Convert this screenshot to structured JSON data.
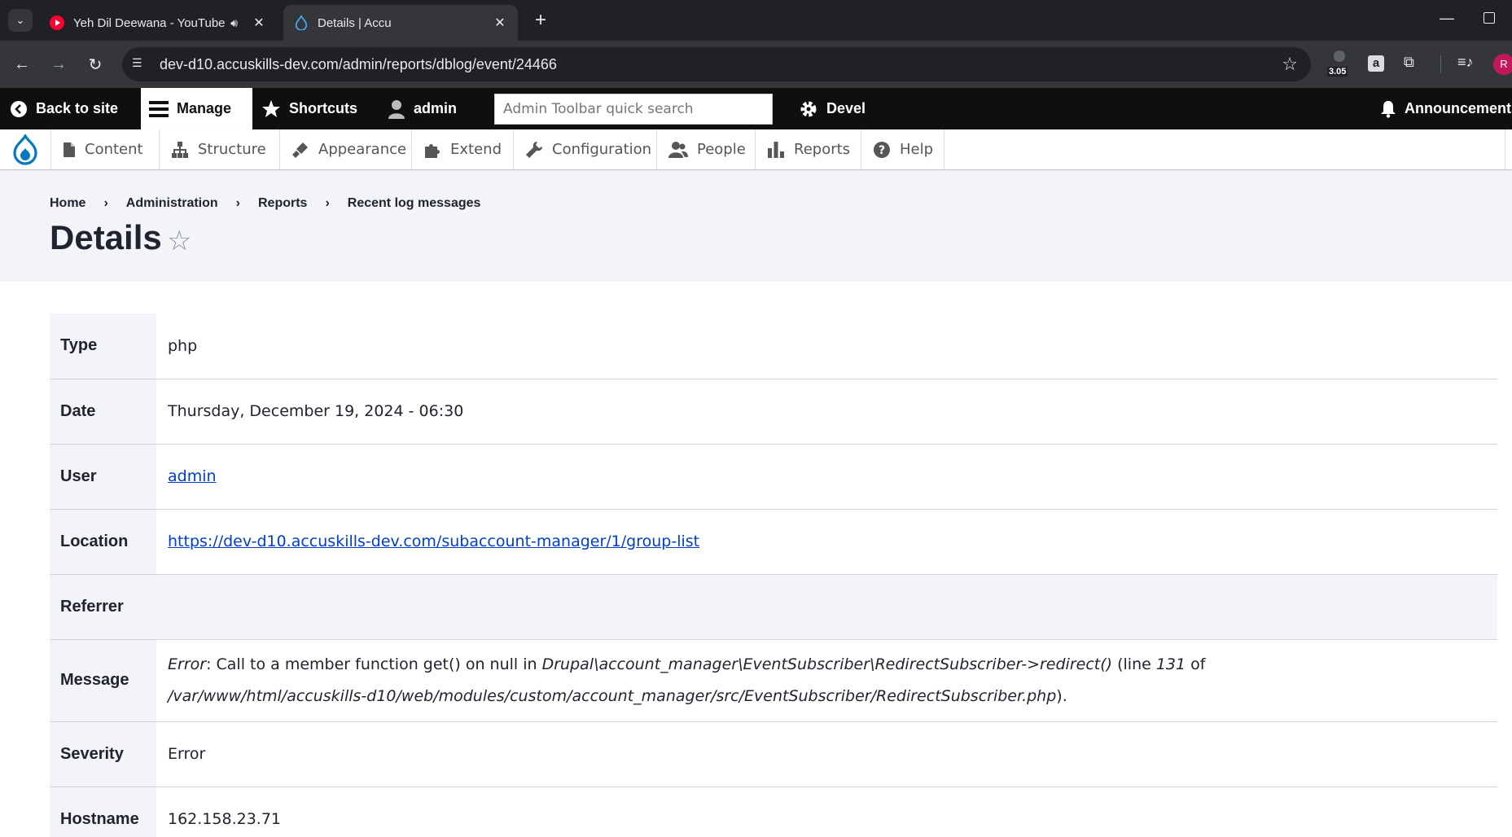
{
  "browser": {
    "tabs": [
      {
        "title": "Yeh Dil Deewana - YouTube",
        "favicon": "youtube-icon",
        "audio": true
      },
      {
        "title": "Details | Accu",
        "favicon": "drupal-icon",
        "active": true
      }
    ],
    "url": "dev-d10.accuskills-dev.com/admin/reports/dblog/event/24466",
    "extension_badge": "3.05",
    "profile_initial": "R"
  },
  "toolbar": {
    "back_to_site": "Back to site",
    "manage": "Manage",
    "shortcuts": "Shortcuts",
    "user": "admin",
    "search_placeholder": "Admin Toolbar quick search",
    "devel": "Devel",
    "announcements": "Announcements"
  },
  "tray": {
    "items": [
      "Content",
      "Structure",
      "Appearance",
      "Extend",
      "Configuration",
      "People",
      "Reports",
      "Help"
    ]
  },
  "breadcrumb": [
    "Home",
    "Administration",
    "Reports",
    "Recent log messages"
  ],
  "page_title": "Details",
  "details": {
    "type_label": "Type",
    "type": "php",
    "date_label": "Date",
    "date": "Thursday, December 19, 2024 - 06:30",
    "user_label": "User",
    "user": "admin",
    "location_label": "Location",
    "location": "https://dev-d10.accuskills-dev.com/subaccount-manager/1/group-list",
    "referrer_label": "Referrer",
    "referrer": "",
    "message_label": "Message",
    "message": {
      "error_type": "Error",
      "text1": ": Call to a member function get() on null in ",
      "function": "Drupal\\account_manager\\EventSubscriber\\RedirectSubscriber->redirect()",
      "text2": " (line ",
      "line": "131",
      "text3": " of ",
      "file": "/var/www/html/accuskills-d10/web/modules/custom/account_manager/src/EventSubscriber/RedirectSubscriber.php",
      "text4": ")."
    },
    "severity_label": "Severity",
    "severity": "Error",
    "hostname_label": "Hostname",
    "hostname": "162.158.23.71"
  },
  "colors": {
    "toolbar_bg": "#0f0f0f",
    "header_bg": "#f2f4f8",
    "link": "#003ecc",
    "drupal_blue": "#0678be"
  }
}
